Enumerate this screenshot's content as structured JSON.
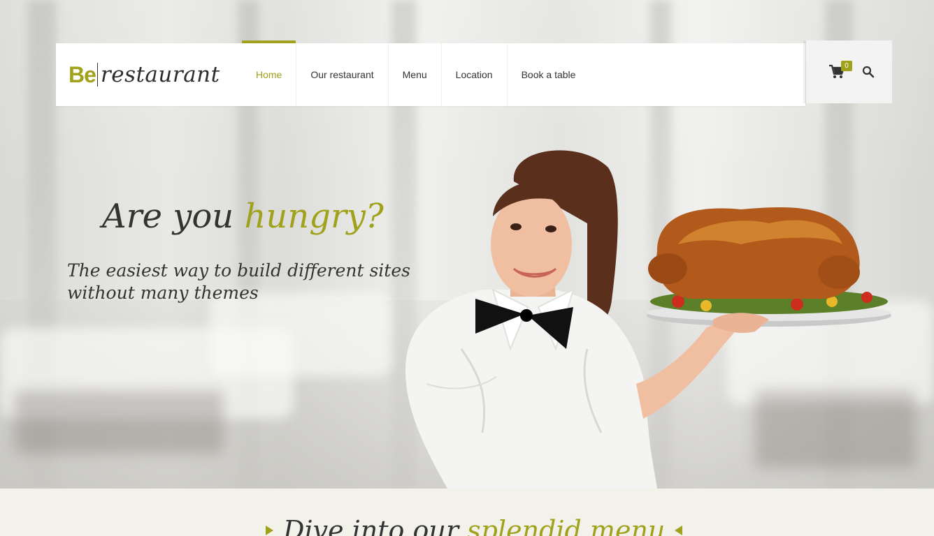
{
  "brand": {
    "logo_be": "Be",
    "logo_name": "restaurant",
    "accent_color": "#9fa21a"
  },
  "nav": {
    "items": [
      {
        "label": "Home",
        "active": true
      },
      {
        "label": "Our restaurant",
        "active": false
      },
      {
        "label": "Menu",
        "active": false
      },
      {
        "label": "Location",
        "active": false
      },
      {
        "label": "Book a table",
        "active": false
      }
    ]
  },
  "tools": {
    "cart_icon": "cart-icon",
    "cart_count": "0",
    "search_icon": "search-icon"
  },
  "hero": {
    "headline_start": "Are you ",
    "headline_accent": "hungry?",
    "tagline_line1": "The easiest way to build different sites",
    "tagline_line2": "without many themes"
  },
  "section": {
    "title_start": "Dive into our ",
    "title_accent": "splendid menu"
  }
}
